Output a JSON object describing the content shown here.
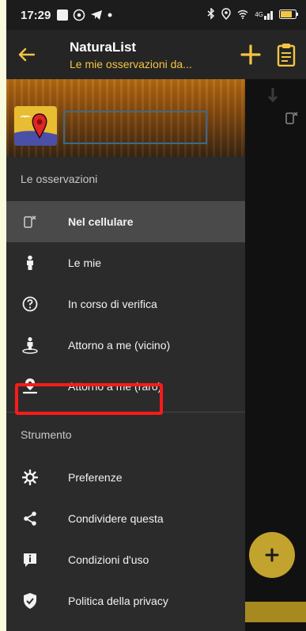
{
  "status_bar": {
    "time": "17:29",
    "network": "4G"
  },
  "app_bar": {
    "title": "NaturaList",
    "subtitle": "Le mie osservazioni da..."
  },
  "drawer": {
    "section_observations": "Le osservazioni",
    "observation_items": [
      {
        "label": "Nel cellulare",
        "icon": "phone-sync-icon",
        "active": true
      },
      {
        "label": "Le mie",
        "icon": "person-icon"
      },
      {
        "label": "In corso di verifica",
        "icon": "question-circle-icon"
      },
      {
        "label": "Attorno a me (vicino)",
        "icon": "person-location-icon"
      },
      {
        "label": "Attorno a me (raro)",
        "icon": "location-pin-icon"
      }
    ],
    "section_tools": "Strumento",
    "tool_items": [
      {
        "label": "Preferenze",
        "icon": "gear-icon"
      },
      {
        "label": "Condividere questa",
        "icon": "share-icon"
      },
      {
        "label": "Condizioni d'uso",
        "icon": "info-icon"
      },
      {
        "label": "Politica della privacy",
        "icon": "shield-check-icon"
      }
    ]
  },
  "colors": {
    "accent": "#f4c542",
    "highlight": "#ff1a1a",
    "fab": "#c2a32d"
  }
}
